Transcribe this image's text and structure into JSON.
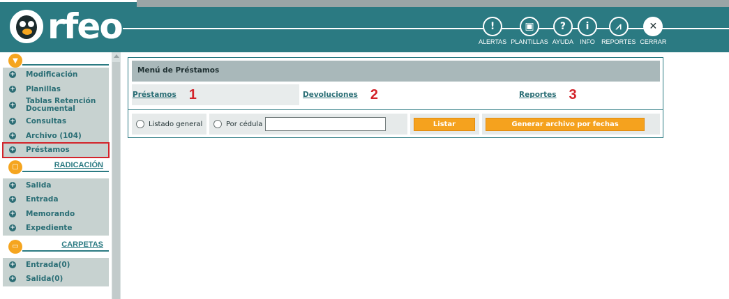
{
  "header": {
    "brand": "rfeo",
    "nav": [
      {
        "key": "alertas",
        "label": "ALERTAS",
        "icon": "!"
      },
      {
        "key": "plantillas",
        "label": "PLANTILLAS",
        "icon": "▣"
      },
      {
        "key": "ayuda",
        "label": "AYUDA",
        "icon": "?"
      },
      {
        "key": "info",
        "label": "INFO",
        "icon": "i"
      },
      {
        "key": "reportes",
        "label": "REPORTES",
        "icon": "⩘"
      },
      {
        "key": "cerrar",
        "label": "CERRAR",
        "icon": "✕"
      }
    ]
  },
  "sidebar": {
    "main_items": [
      {
        "label": "Modificación"
      },
      {
        "label": "Planillas"
      },
      {
        "label": "Tablas Retención Documental"
      },
      {
        "label": "Consultas"
      },
      {
        "label": "Archivo (104)"
      },
      {
        "label": "Préstamos"
      }
    ],
    "radicacion": {
      "title": "RADICACIÓN",
      "items": [
        {
          "label": "Salida"
        },
        {
          "label": "Entrada"
        },
        {
          "label": "Memorando"
        },
        {
          "label": "Expediente"
        }
      ]
    },
    "carpetas": {
      "title": "CARPETAS",
      "items": [
        {
          "label": "Entrada(0)"
        },
        {
          "label": "Salida(0)"
        }
      ]
    }
  },
  "main": {
    "title": "Menú de Préstamos",
    "links": [
      {
        "label": "Préstamos",
        "number": "1"
      },
      {
        "label": "Devoluciones",
        "number": "2"
      },
      {
        "label": "Reportes",
        "number": "3"
      }
    ],
    "form": {
      "radio_general": "Listado general",
      "radio_cedula": "Por cédula",
      "cedula_value": "",
      "btn_listar": "Listar",
      "btn_generar": "Generar archivo por fechas"
    }
  },
  "colors": {
    "header_teal": "#2b7a82",
    "accent_orange": "#f5a51f",
    "highlight_red": "#d3242b"
  }
}
